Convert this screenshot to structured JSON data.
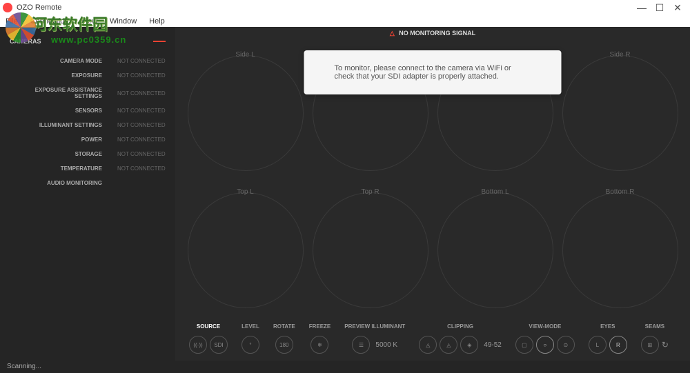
{
  "window": {
    "title": "OZO Remote",
    "menu": [
      "File",
      "Connection",
      "View",
      "Window",
      "Help"
    ]
  },
  "watermark": {
    "line1": "河东软件园",
    "line2": "www.pc0359.cn"
  },
  "sidebar": {
    "header": "CAMERAS",
    "minus": "—",
    "rows": [
      {
        "label": "CAMERA MODE",
        "value": "NOT CONNECTED"
      },
      {
        "label": "EXPOSURE",
        "value": "NOT CONNECTED"
      },
      {
        "label": "EXPOSURE ASSISTANCE SETTINGS",
        "value": "NOT CONNECTED"
      },
      {
        "label": "SENSORS",
        "value": "NOT CONNECTED"
      },
      {
        "label": "ILLUMINANT SETTINGS",
        "value": "NOT CONNECTED"
      },
      {
        "label": "POWER",
        "value": "NOT CONNECTED"
      },
      {
        "label": "STORAGE",
        "value": "NOT CONNECTED"
      },
      {
        "label": "TEMPERATURE",
        "value": "NOT CONNECTED"
      },
      {
        "label": "AUDIO MONITORING",
        "value": ""
      }
    ]
  },
  "main": {
    "warning": "NO MONITORING SIGNAL",
    "notice": "To monitor, please connect to the camera via WiFi or check that your SDI adapter is properly attached.",
    "cells": [
      "Side L",
      "",
      "",
      "Side R",
      "Top L",
      "Top R",
      "Bottom L",
      "Bottom R"
    ]
  },
  "toolbar": {
    "source": {
      "label": "SOURCE",
      "b1": "((·))",
      "b2": "SDI"
    },
    "level": {
      "label": "LEVEL",
      "b1": "°"
    },
    "rotate": {
      "label": "ROTATE",
      "b1": "180"
    },
    "freeze": {
      "label": "FREEZE",
      "b1": "❄"
    },
    "illum": {
      "label": "PREVIEW ILLUMINANT",
      "b1": "☰",
      "value": "5000 K"
    },
    "clipping": {
      "label": "CLIPPING",
      "b1": "◬",
      "b2": "◬",
      "b3": "◈",
      "value": "49-52"
    },
    "viewmode": {
      "label": "VIEW-MODE",
      "b1": "▢",
      "b2": "○",
      "b3": "⊙"
    },
    "eyes": {
      "label": "EYES",
      "b1": "L",
      "b2": "R"
    },
    "seams": {
      "label": "SEAMS",
      "b1": "⊞",
      "b2": "↻"
    }
  },
  "status": "Scanning..."
}
